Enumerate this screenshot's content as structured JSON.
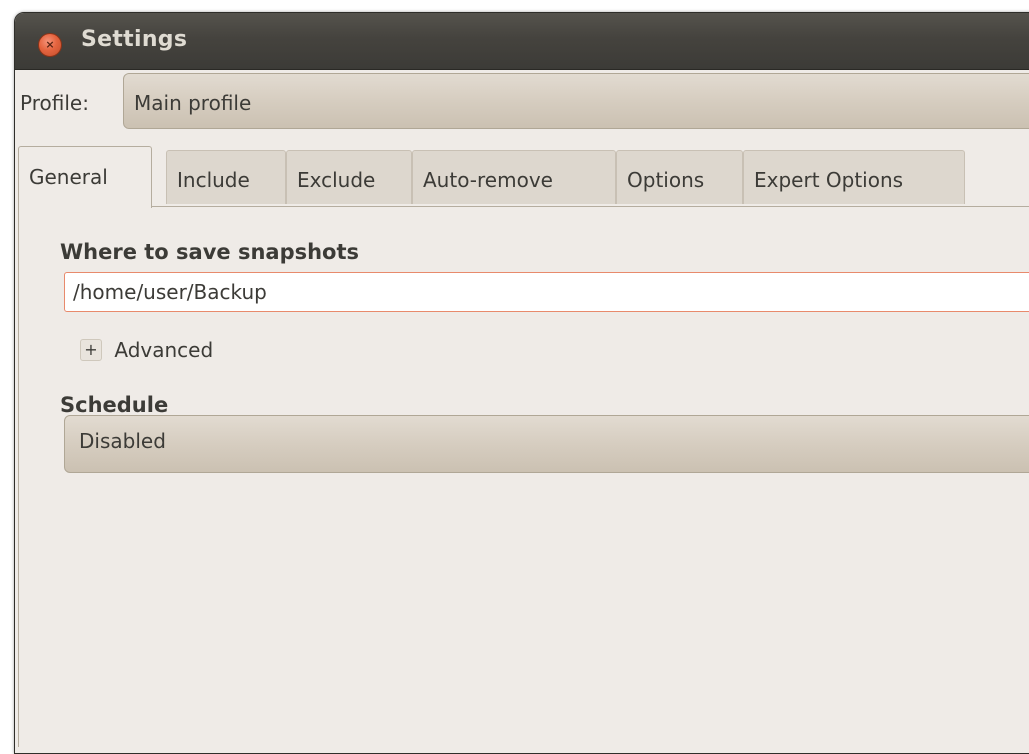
{
  "window": {
    "title": "Settings",
    "close_glyph": "×"
  },
  "profile": {
    "label": "Profile:",
    "value": "Main profile"
  },
  "tabs": [
    {
      "label": "General",
      "active": true
    },
    {
      "label": "Include",
      "active": false
    },
    {
      "label": "Exclude",
      "active": false
    },
    {
      "label": "Auto-remove",
      "active": false
    },
    {
      "label": "Options",
      "active": false
    },
    {
      "label": "Expert Options",
      "active": false
    }
  ],
  "general": {
    "save_heading": "Where to save snapshots",
    "save_path": "/home/user/Backup",
    "advanced_toggle": "+",
    "advanced_label": "Advanced",
    "schedule_heading": "Schedule",
    "schedule_value": "Disabled"
  },
  "colors": {
    "titlebar": "#3c3b37",
    "close_button": "#e5643f",
    "window_bg": "#efebe7",
    "input_focus_border": "#e88a6c"
  },
  "icons": {
    "close": "close-icon",
    "expander": "plus-expander-icon"
  }
}
